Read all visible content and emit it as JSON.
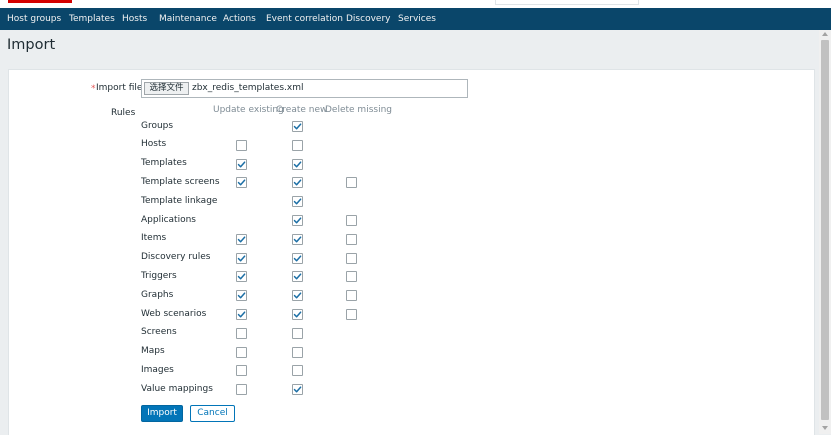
{
  "nav": {
    "items": [
      "Host groups",
      "Templates",
      "Hosts",
      "Maintenance",
      "Actions",
      "Event correlation",
      "Discovery",
      "Services"
    ]
  },
  "page": {
    "title": "Import"
  },
  "form": {
    "required_mark": "*",
    "import_file_label": "Import file",
    "file_button_label": "选择文件",
    "file_name": "zbx_redis_templates.xml",
    "rules_label": "Rules",
    "columns": [
      "Update existing",
      "Create new",
      "Delete missing"
    ],
    "rules": [
      {
        "label": "Groups",
        "update_existing": null,
        "create_new": true,
        "delete_missing": null
      },
      {
        "label": "Hosts",
        "update_existing": false,
        "create_new": false,
        "delete_missing": null
      },
      {
        "label": "Templates",
        "update_existing": true,
        "create_new": true,
        "delete_missing": null
      },
      {
        "label": "Template screens",
        "update_existing": true,
        "create_new": true,
        "delete_missing": false
      },
      {
        "label": "Template linkage",
        "update_existing": null,
        "create_new": true,
        "delete_missing": null
      },
      {
        "label": "Applications",
        "update_existing": null,
        "create_new": true,
        "delete_missing": false
      },
      {
        "label": "Items",
        "update_existing": true,
        "create_new": true,
        "delete_missing": false
      },
      {
        "label": "Discovery rules",
        "update_existing": true,
        "create_new": true,
        "delete_missing": false
      },
      {
        "label": "Triggers",
        "update_existing": true,
        "create_new": true,
        "delete_missing": false
      },
      {
        "label": "Graphs",
        "update_existing": true,
        "create_new": true,
        "delete_missing": false
      },
      {
        "label": "Web scenarios",
        "update_existing": true,
        "create_new": true,
        "delete_missing": false
      },
      {
        "label": "Screens",
        "update_existing": false,
        "create_new": false,
        "delete_missing": null
      },
      {
        "label": "Maps",
        "update_existing": false,
        "create_new": false,
        "delete_missing": null
      },
      {
        "label": "Images",
        "update_existing": false,
        "create_new": false,
        "delete_missing": null
      },
      {
        "label": "Value mappings",
        "update_existing": false,
        "create_new": true,
        "delete_missing": null
      }
    ],
    "import_button_label": "Import",
    "cancel_button_label": "Cancel"
  },
  "colors": {
    "nav_bg": "#0a466a",
    "primary": "#0275b8",
    "check": "#1c6fa6",
    "required": "#e45959"
  },
  "icons": {
    "checkbox_checked": "checkmark-icon"
  }
}
